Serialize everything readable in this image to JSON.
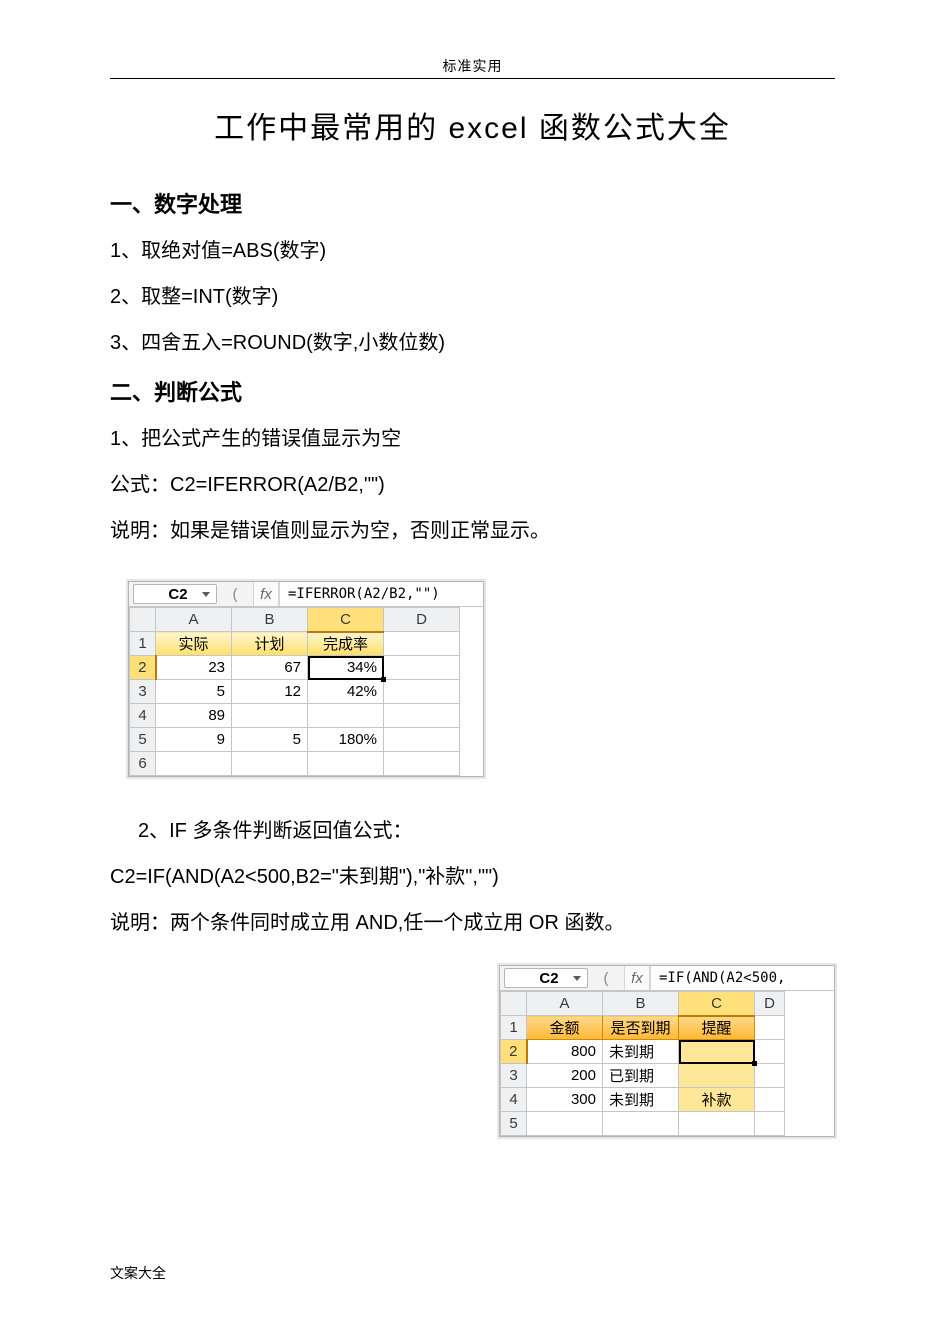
{
  "header": {
    "label": "标准实用"
  },
  "title": "工作中最常用的 excel 函数公式大全",
  "section1": {
    "heading": "一、数字处理",
    "item1": "1、取绝对值=ABS(数字)",
    "item2": "2、取整=INT(数字)",
    "item3": "3、四舍五入=ROUND(数字,小数位数)"
  },
  "section2": {
    "heading": "二、判断公式",
    "item1": "1、把公式产生的错误值显示为空",
    "formula1_line": "公式：C2=IFERROR(A2/B2,\"\")",
    "note1": "说明：如果是错误值则显示为空，否则正常显示。",
    "item2": "2、IF 多条件判断返回值公式：",
    "formula2_line": "C2=IF(AND(A2<500,B2=\"未到期\"),\"补款\",\"\")",
    "note2": "说明：两个条件同时成立用 AND,任一个成立用 OR 函数。"
  },
  "excel1": {
    "name_box": "C2",
    "fx": "fx",
    "formula_bar": "=IFERROR(A2/B2,\"\")",
    "open_paren": "(",
    "cols": {
      "A": "A",
      "B": "B",
      "C": "C",
      "D": "D"
    },
    "rownums": {
      "r1": "1",
      "r2": "2",
      "r3": "3",
      "r4": "4",
      "r5": "5",
      "r6": "6"
    },
    "hdrA": "实际",
    "hdrB": "计划",
    "hdrC": "完成率",
    "rows": [
      {
        "a": "23",
        "b": "67",
        "c": "34%"
      },
      {
        "a": "5",
        "b": "12",
        "c": "42%"
      },
      {
        "a": "89",
        "b": "",
        "c": ""
      },
      {
        "a": "9",
        "b": "5",
        "c": "180%"
      }
    ]
  },
  "excel2": {
    "name_box": "C2",
    "fx": "fx",
    "formula_bar": "=IF(AND(A2<500,",
    "open_paren": "(",
    "cols": {
      "A": "A",
      "B": "B",
      "C": "C",
      "D": "D"
    },
    "rownums": {
      "r1": "1",
      "r2": "2",
      "r3": "3",
      "r4": "4",
      "r5": "5"
    },
    "hdrA": "金额",
    "hdrB": "是否到期",
    "hdrC": "提醒",
    "rows": [
      {
        "a": "800",
        "b": "未到期",
        "c": ""
      },
      {
        "a": "200",
        "b": "已到期",
        "c": ""
      },
      {
        "a": "300",
        "b": "未到期",
        "c": "补款"
      }
    ]
  },
  "footer": {
    "label": "文案大全"
  }
}
